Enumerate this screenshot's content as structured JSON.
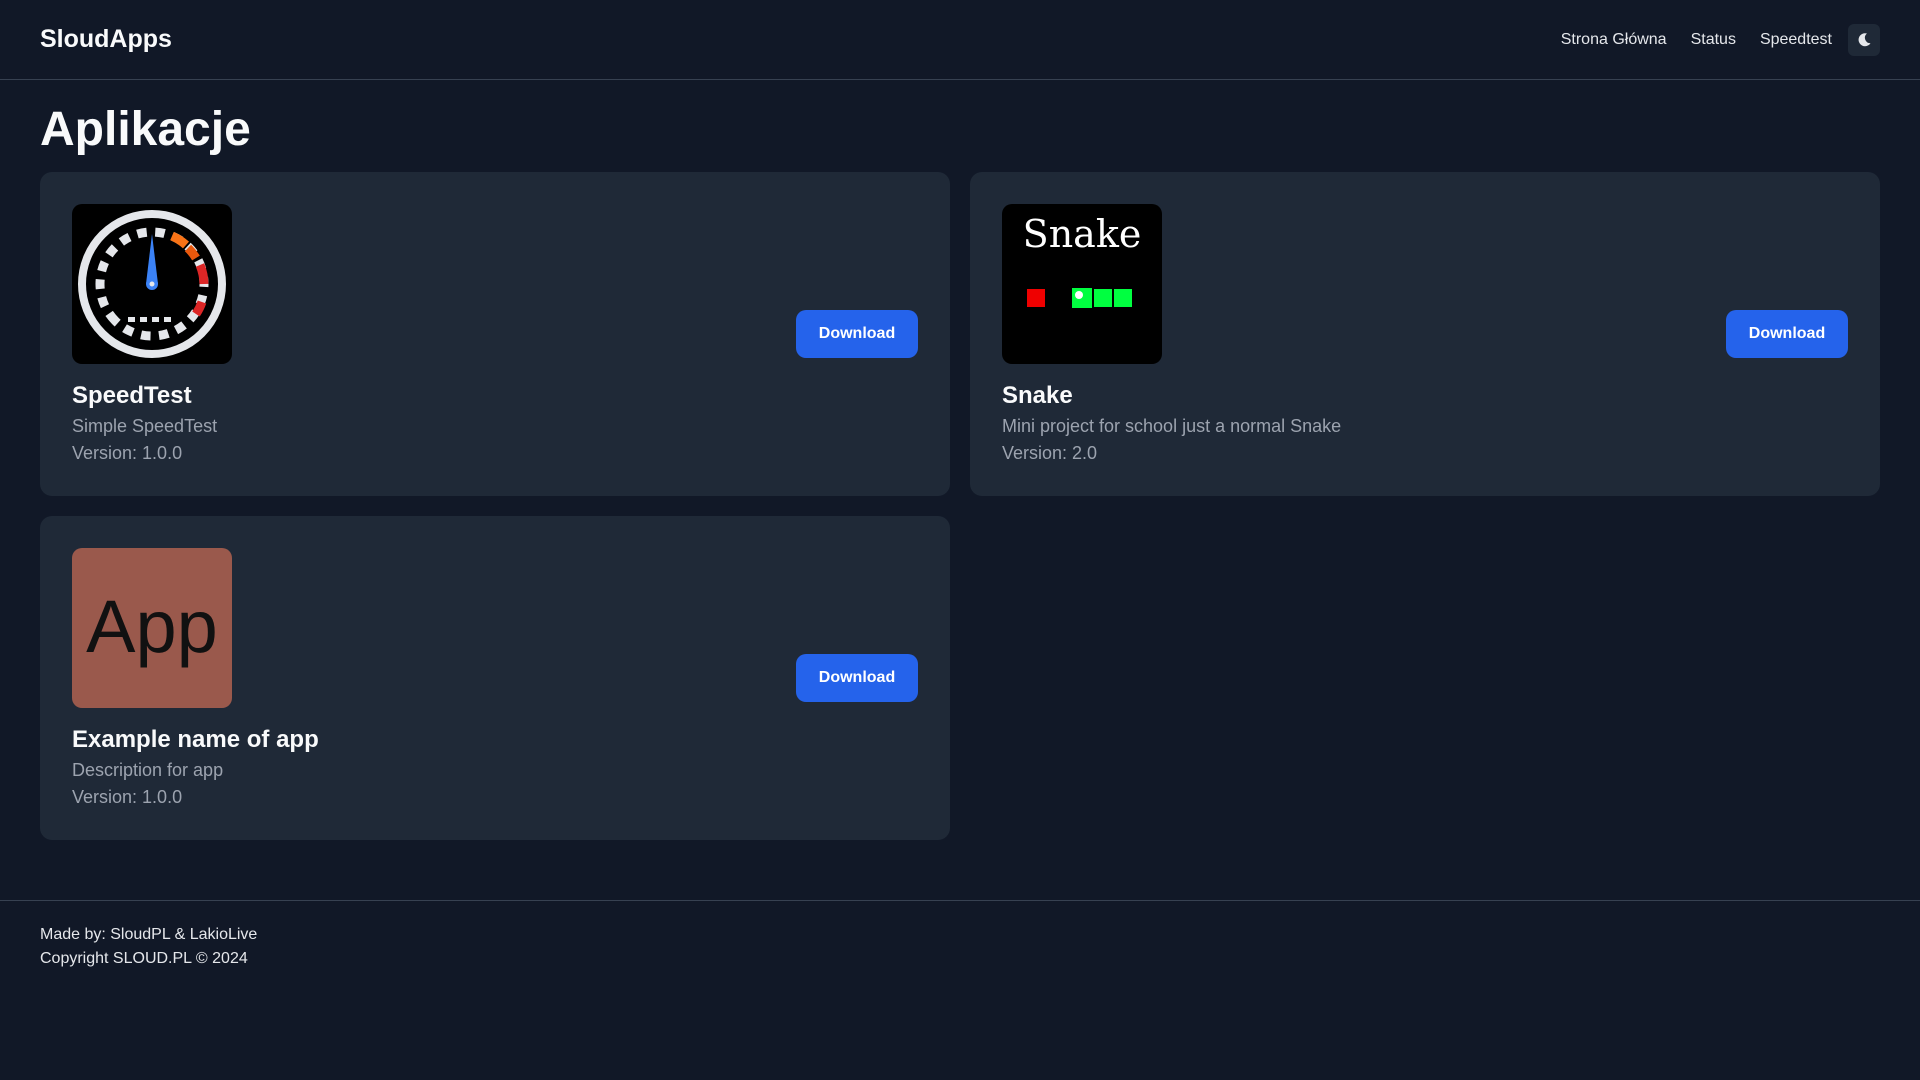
{
  "navbar": {
    "brand": "SloudApps",
    "links": [
      "Strona Główna",
      "Status",
      "Speedtest"
    ],
    "theme_icon": "moon-icon"
  },
  "page": {
    "title": "Aplikacje"
  },
  "apps": [
    {
      "name": "SpeedTest",
      "description": "Simple SpeedTest",
      "version": "Version: 1.0.0",
      "icon": "speedometer-icon",
      "button": "Download"
    },
    {
      "name": "Snake",
      "description": "Mini project for school just a normal Snake",
      "version": "Version: 2.0",
      "icon": "snake-game-icon",
      "icon_text": "Snake",
      "button": "Download"
    },
    {
      "name": "Example name of app",
      "description": "Description for app",
      "version": "Version: 1.0.0",
      "icon": "app-placeholder-icon",
      "icon_text": "App",
      "button": "Download"
    }
  ],
  "footer": {
    "made_by": "Made by: SloudPL & LakioLive",
    "copyright": "Copyright SLOUD.PL © 2024"
  },
  "colors": {
    "background": "#111827",
    "card": "#1f2937",
    "accent": "#2563eb",
    "muted_text": "#9ca3af"
  }
}
